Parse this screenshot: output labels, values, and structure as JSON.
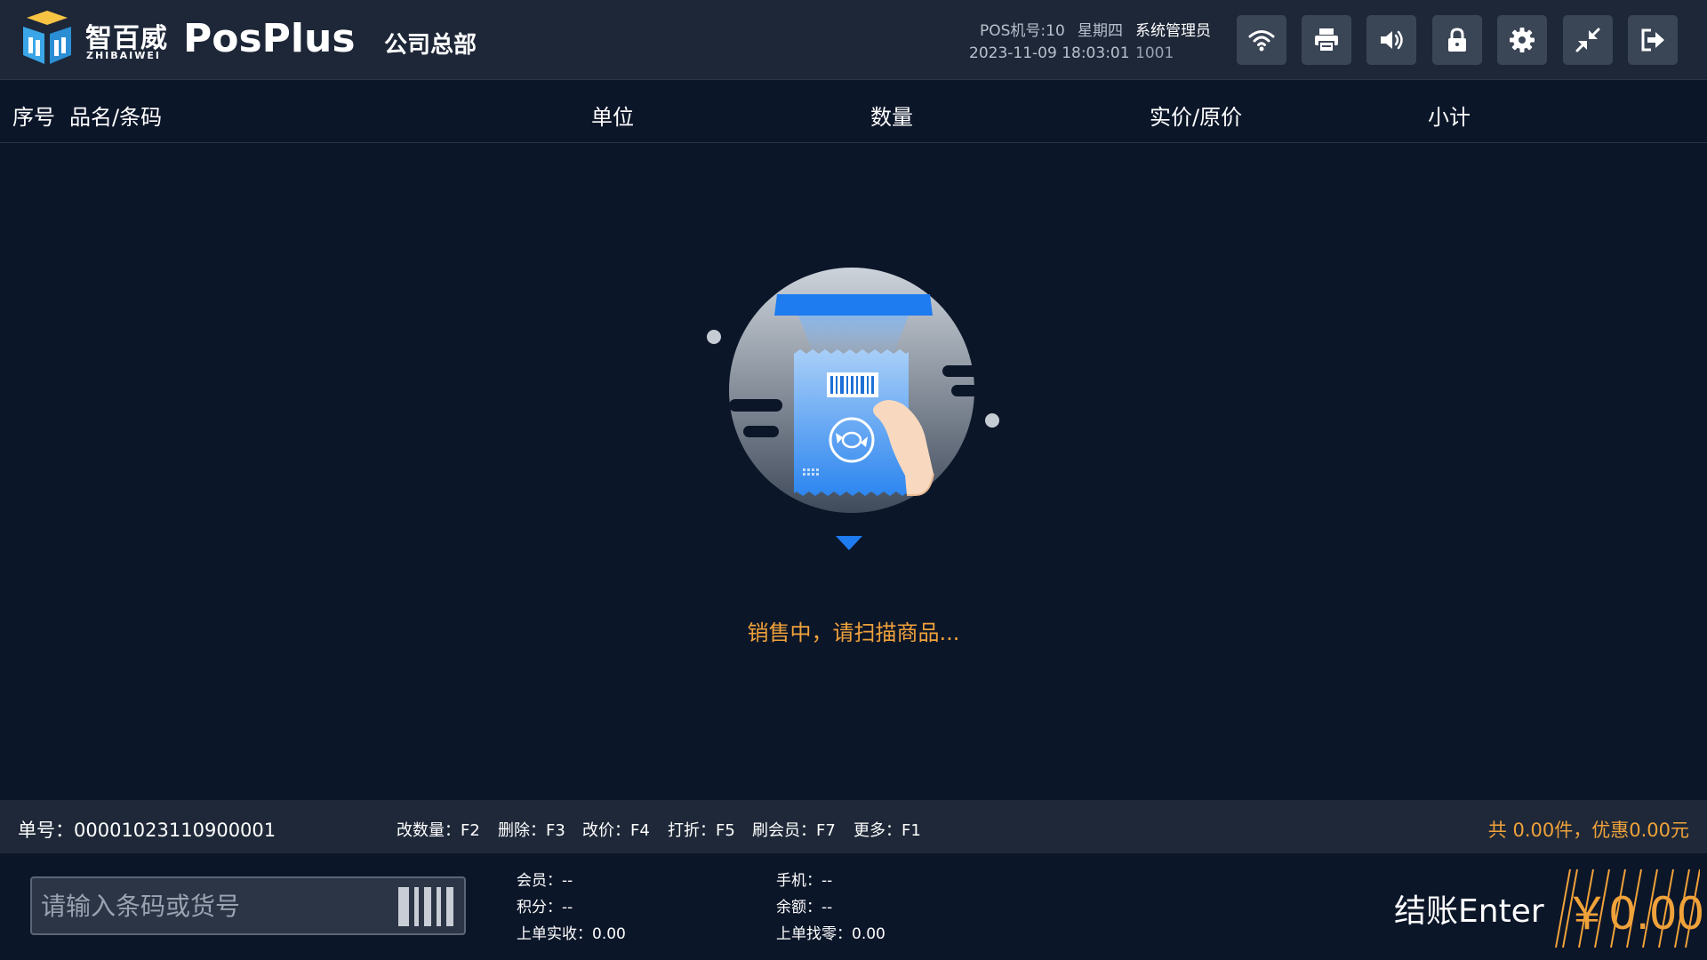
{
  "header": {
    "logo_cn": "智百威",
    "logo_en": "ZHIBAIWEI",
    "app_name": "PosPlus",
    "store_name": "公司总部",
    "pos_no": "POS机号:10",
    "weekday": "星期四",
    "user_role": "系统管理员",
    "datetime": "2023-11-09 18:03:01",
    "user_id": "1001",
    "buttons": [
      "wifi-icon",
      "printer-icon",
      "volume-icon",
      "lock-icon",
      "gear-icon",
      "minimize-icon",
      "logout-icon"
    ]
  },
  "columns": {
    "seq": "序号",
    "name": "品名/条码",
    "unit": "单位",
    "qty": "数量",
    "price": "实价/原价",
    "subtotal": "小计"
  },
  "empty_state": {
    "message": "销售中，请扫描商品..."
  },
  "infobar": {
    "order_no": "单号：00001023110900001",
    "shortcuts": [
      "改数量：F2",
      "删除：F3",
      "改价：F4",
      "打折：F5",
      "刷会员：F7",
      "更多：F1"
    ],
    "summary": "共 0.00件，优惠0.00元"
  },
  "bottom": {
    "barcode_placeholder": "请输入条码或货号",
    "member": "会员：--",
    "points": "积分：--",
    "last_paid": "上单实收：0.00",
    "phone": "手机：--",
    "balance": "余额：--",
    "last_change": "上单找零：0.00",
    "checkout_label": "结账Enter",
    "amount": "￥0.00"
  },
  "colors": {
    "background": "#0c1629",
    "bar": "#1e2838",
    "accent_orange": "#f0a23a",
    "accent_blue": "#2f8cff"
  }
}
